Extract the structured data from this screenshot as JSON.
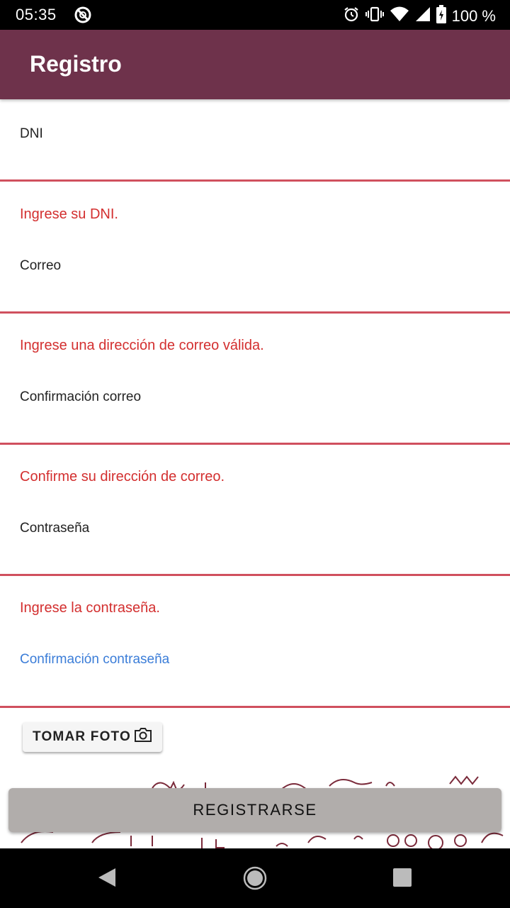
{
  "status_bar": {
    "time": "05:35",
    "battery": "100 %"
  },
  "app_bar": {
    "title": "Registro"
  },
  "form": {
    "fields": [
      {
        "label": "DNI",
        "error": "Ingrese su DNI."
      },
      {
        "label": "Correo",
        "error": "Ingrese una dirección de correo válida."
      },
      {
        "label": "Confirmación correo",
        "error": "Confirme su dirección de correo."
      },
      {
        "label": "Contraseña",
        "error": "Ingrese la contraseña."
      },
      {
        "label": "Confirmación contraseña",
        "error": ""
      }
    ]
  },
  "buttons": {
    "take_photo": "TOMAR FOTO",
    "register": "REGISTRARSE"
  },
  "colors": {
    "app_bar": "#6e324b",
    "error": "#d32f2f",
    "underline": "#d0505e",
    "focus": "#3b7dd8",
    "register_button": "#b1adab"
  }
}
